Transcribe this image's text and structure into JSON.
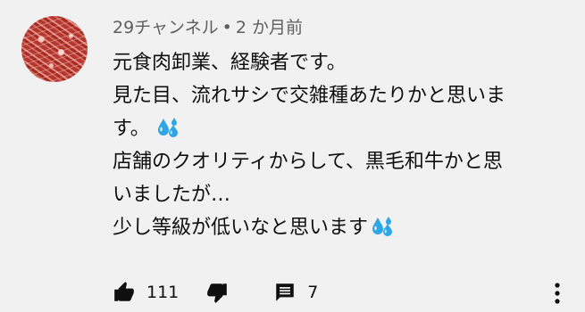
{
  "comment": {
    "author": "29チャンネル",
    "separator": "•",
    "time": "2 か月前",
    "lines": [
      "元食肉卸業、経験者です。",
      "見た目、流れサシで交雑種あたりかと思いま",
      "す。",
      "店舗のクオリティからして、黒毛和牛かと思",
      "いましたが…",
      "少し等級が低いなと思います"
    ],
    "emoji_name": "sweat-droplets-icon"
  },
  "actions": {
    "like_count": "111",
    "reply_count": "7",
    "icons": {
      "like": "thumbs-up-icon",
      "dislike": "thumbs-down-icon",
      "reply": "comment-icon",
      "more": "vertical-dots-icon"
    }
  },
  "colors": {
    "background": "#f1f1f1",
    "text": "#0f0f0f",
    "meta": "#606060",
    "emoji_blue": "#2ea6e6"
  }
}
